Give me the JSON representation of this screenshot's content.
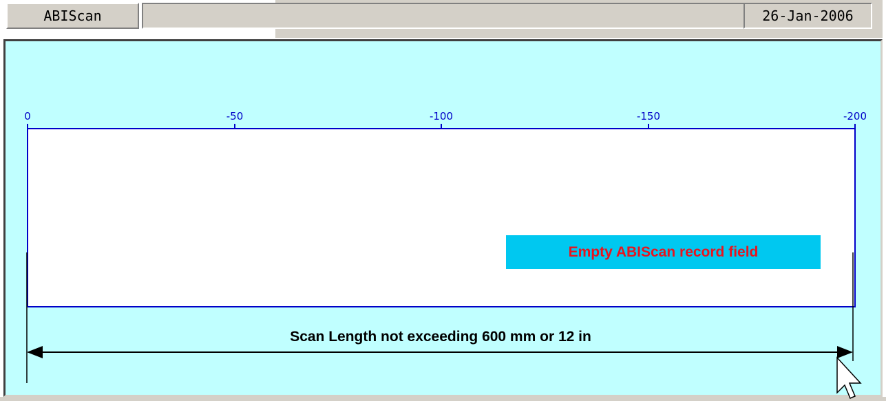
{
  "statusbar": {
    "app_name": "ABIScan",
    "message": "",
    "date": "26-Jan-2006"
  },
  "scale": {
    "ticks": [
      "0",
      "-50",
      "-100",
      "-150",
      "-200"
    ],
    "axis_color": "#0000c8"
  },
  "record_field": {
    "callout": "Empty ABIScan record field",
    "callout_bg": "#00c8f0",
    "callout_text_color": "#e8141e"
  },
  "annotation": {
    "scan_length": "Scan Length not exceeding 600 mm or 12 in"
  },
  "colors": {
    "background": "#c0ffff",
    "panel": "#d4d0c8"
  },
  "cursor": {
    "icon": "arrow-pointer-icon"
  }
}
